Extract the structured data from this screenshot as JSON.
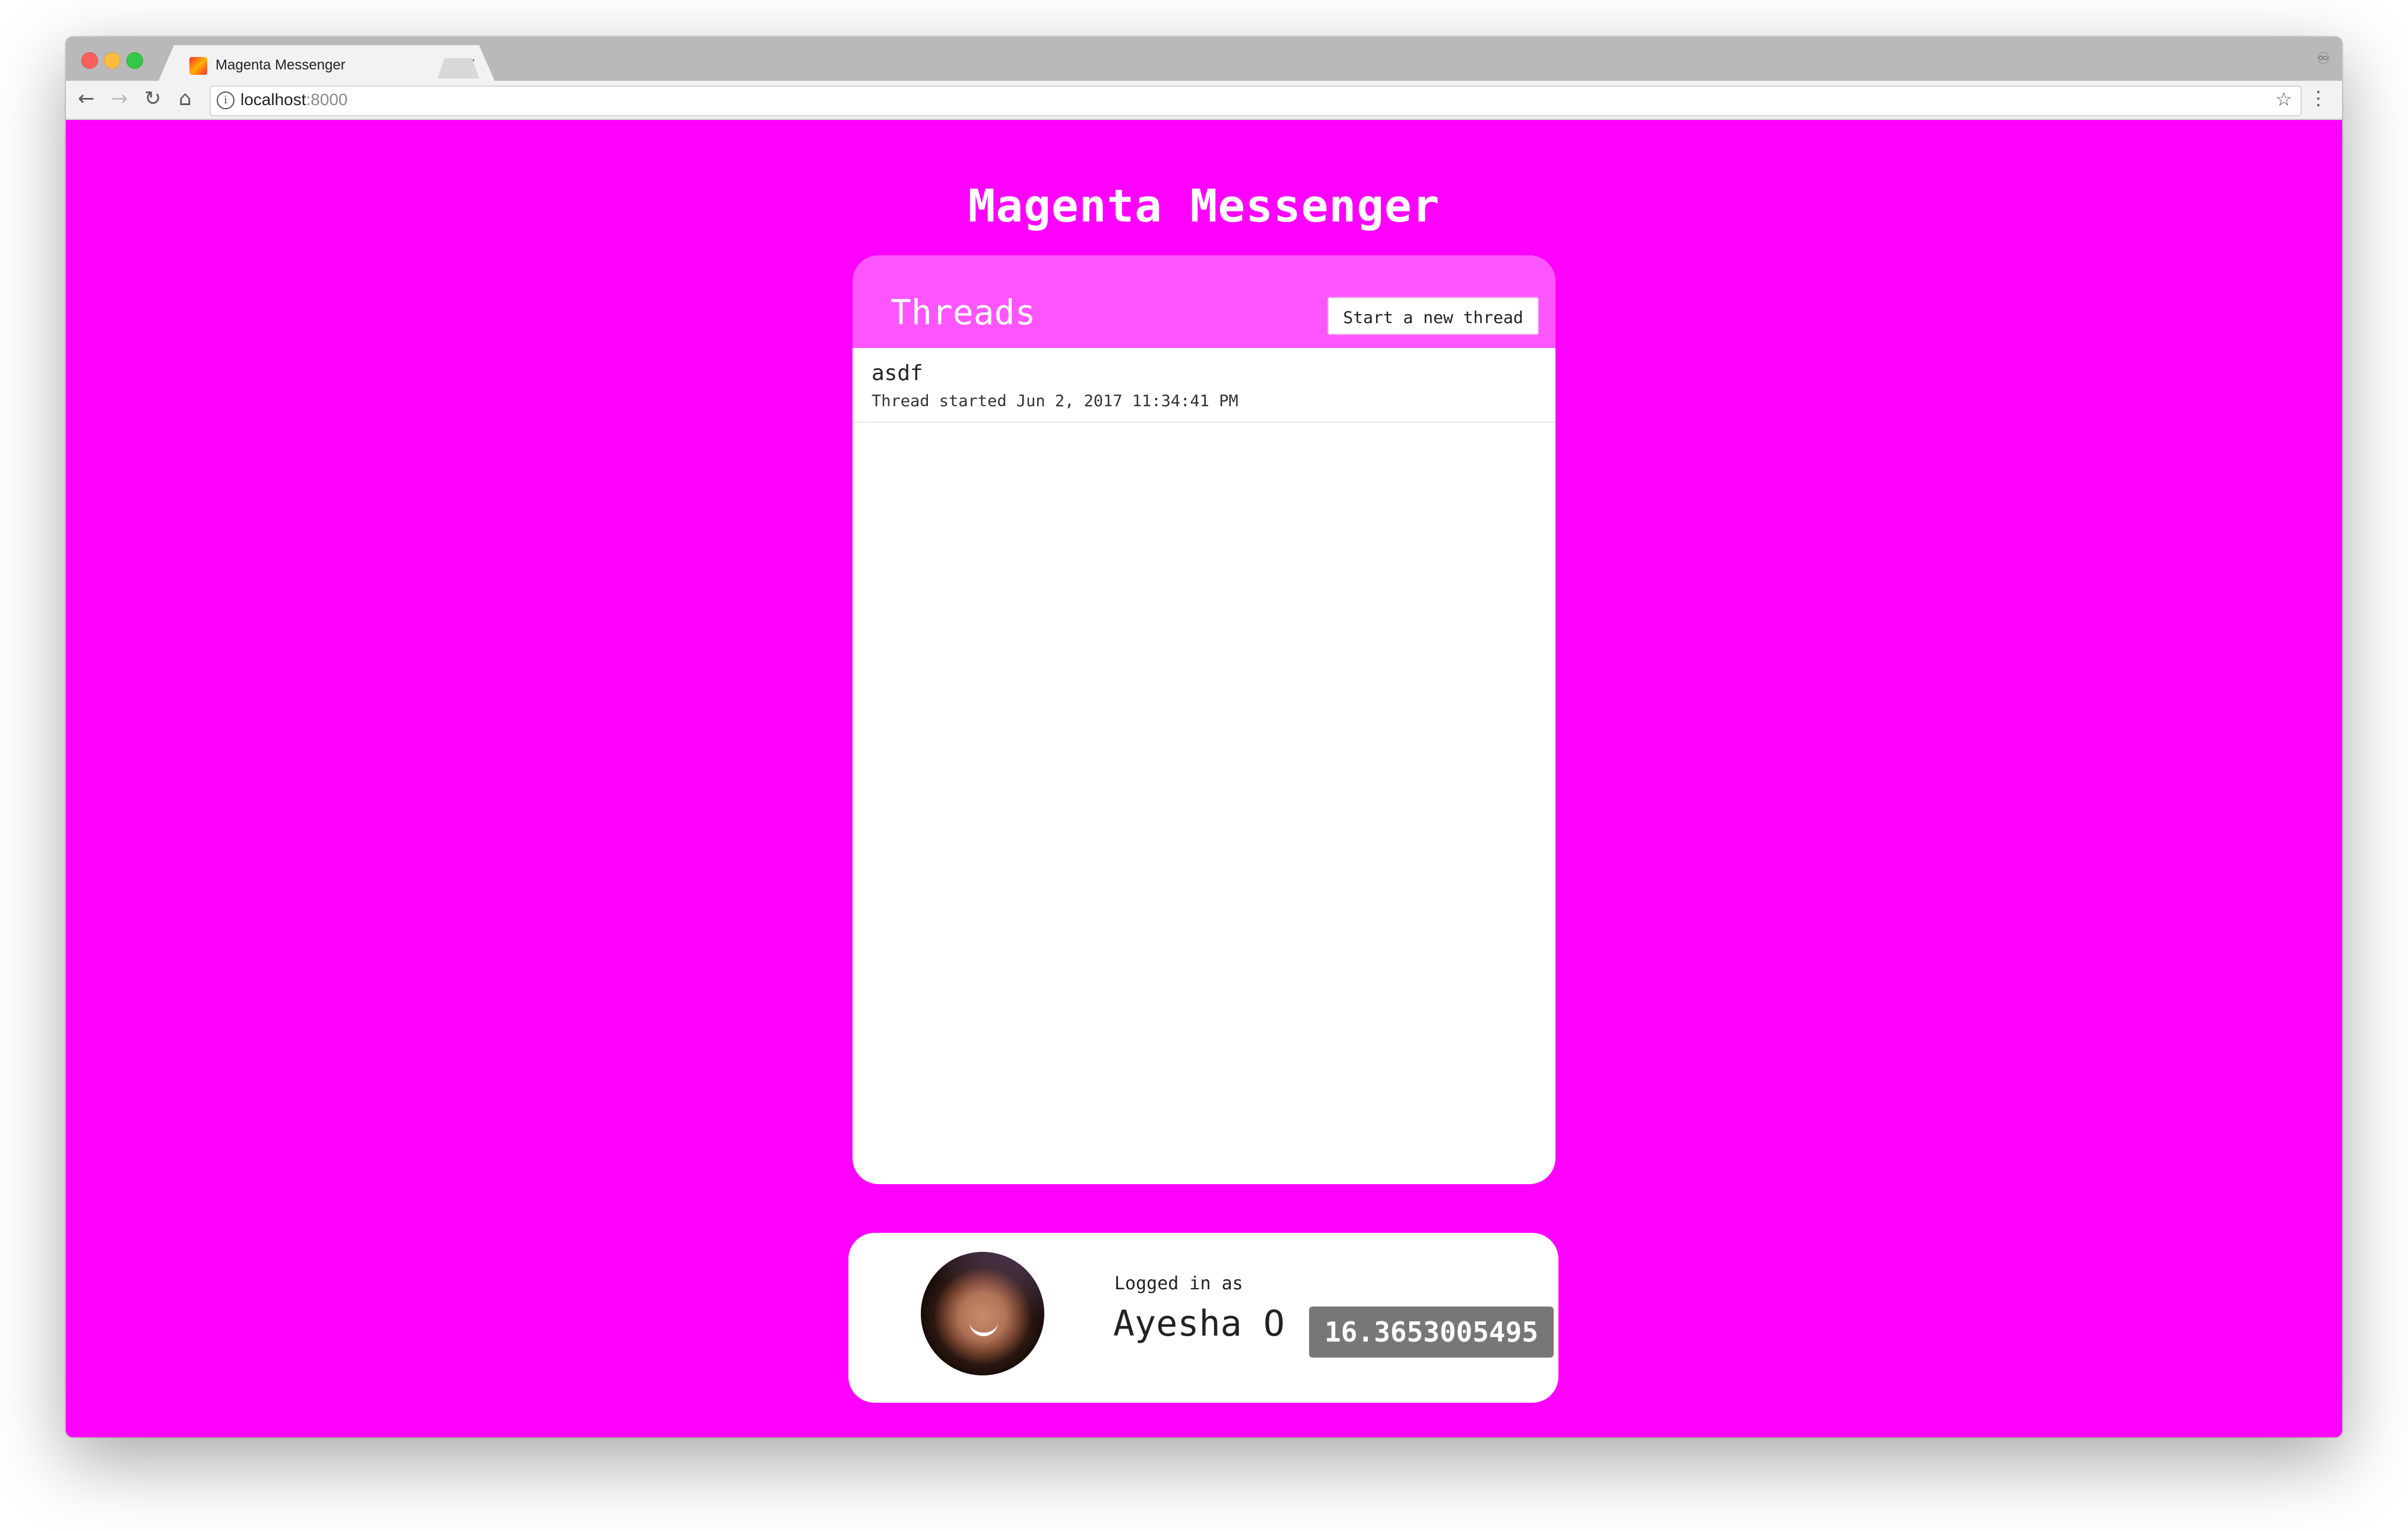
{
  "browser": {
    "tab_title": "Magenta Messenger",
    "tab_close": "×",
    "url_host": "localhost",
    "url_port": ":8000"
  },
  "app": {
    "title": "Magenta Messenger"
  },
  "threads": {
    "heading": "Threads",
    "new_thread_label": "Start a new thread",
    "items": [
      {
        "name": "asdf",
        "meta": "Thread started Jun 2, 2017 11:34:41 PM"
      }
    ]
  },
  "user": {
    "logged_in_label": "Logged in as",
    "name": "Ayesha O",
    "score": "16.3653005495"
  },
  "colors": {
    "background": "#ff00ff",
    "header": "#ff55ff",
    "badge": "#777777"
  },
  "icons": [
    "back-icon",
    "forward-icon",
    "reload-icon",
    "home-icon",
    "info-icon",
    "star-icon",
    "menu-icon",
    "profile-icon",
    "favicon-icon",
    "close-icon"
  ]
}
